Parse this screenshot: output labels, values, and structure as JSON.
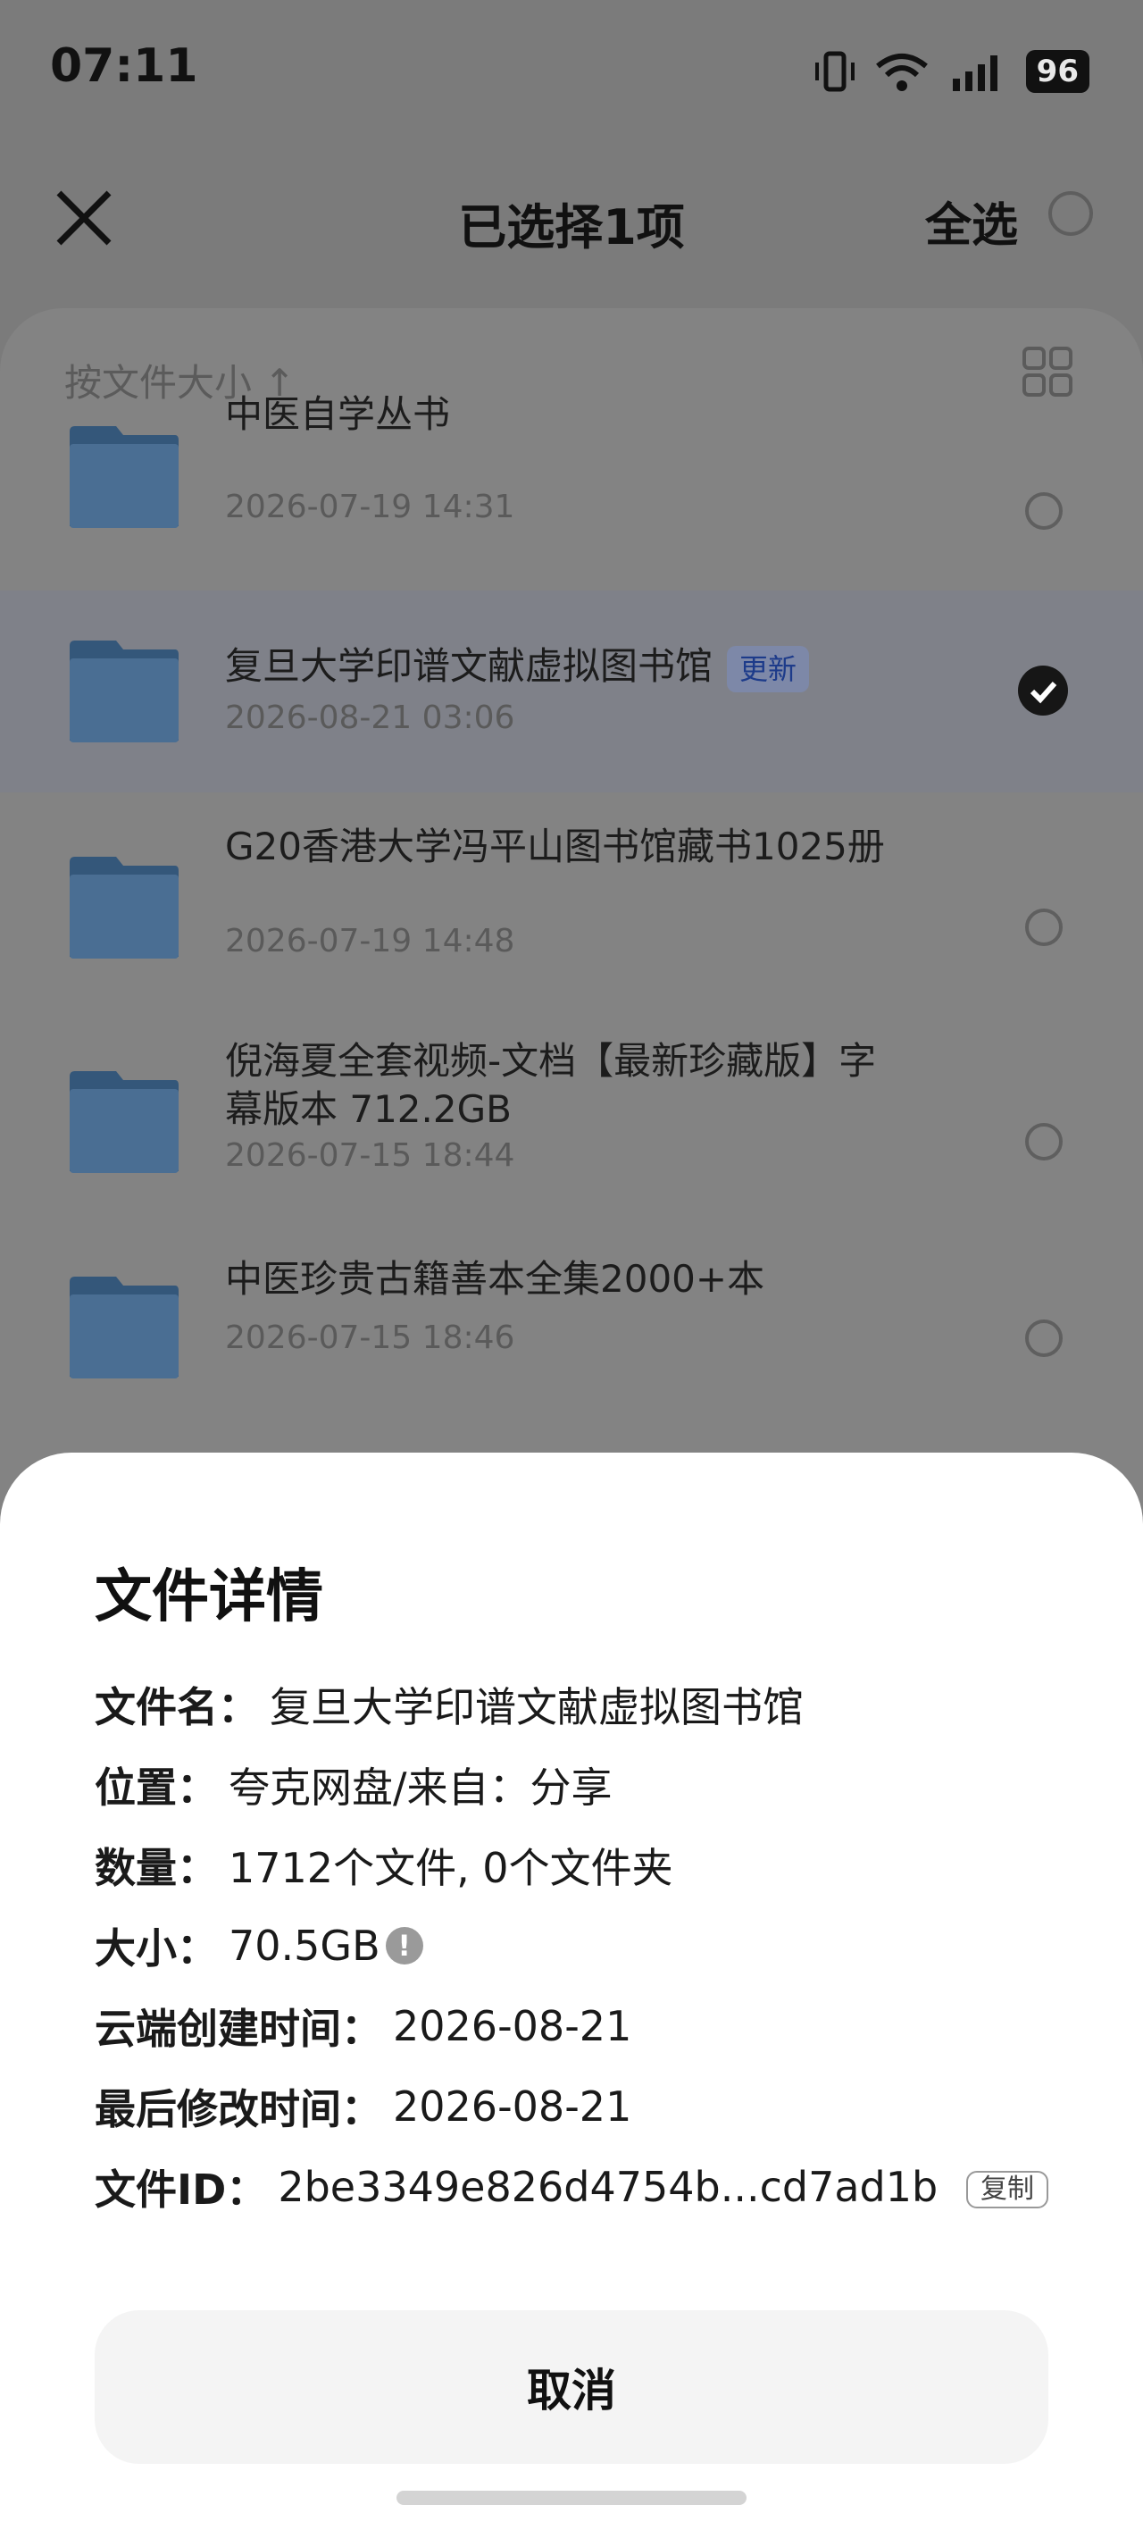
{
  "status": {
    "time": "07:11",
    "battery": "96"
  },
  "topbar": {
    "title": "已选择1项",
    "select_all": "全选"
  },
  "list": {
    "sort_label": "按文件大小",
    "items": [
      {
        "name": "中医自学丛书",
        "date": "2026-07-19 14:31",
        "selected": false
      },
      {
        "name": "复旦大学印谱文献虚拟图书馆",
        "badge": "更新",
        "date": "2026-08-21 03:06",
        "selected": true
      },
      {
        "name": "G20香港大学冯平山图书馆藏书1025册",
        "date": "2026-07-19 14:48",
        "selected": false
      },
      {
        "name": "倪海夏全套视频-文档【最新珍藏版】字幕版本 712.2GB",
        "date": "2026-07-15 18:44",
        "selected": false
      },
      {
        "name": "中医珍贵古籍善本全集2000+本",
        "date": "2026-07-15 18:46",
        "selected": false
      }
    ]
  },
  "sheet": {
    "title": "文件详情",
    "rows": [
      {
        "key": "文件名：",
        "value": "复旦大学印谱文献虚拟图书馆"
      },
      {
        "key": "位置：",
        "value": "夸克网盘/来自：分享"
      },
      {
        "key": "数量：",
        "value": "1712个文件, 0个文件夹"
      },
      {
        "key": "大小：",
        "value": "70.5GB"
      },
      {
        "key": "云端创建时间：",
        "value": "2026-08-21"
      },
      {
        "key": "最后修改时间：",
        "value": "2026-08-21"
      },
      {
        "key": "文件ID：",
        "value": "2be3349e826d4754b...cd7ad1b"
      }
    ],
    "copy_label": "复制",
    "cancel_label": "取消"
  }
}
